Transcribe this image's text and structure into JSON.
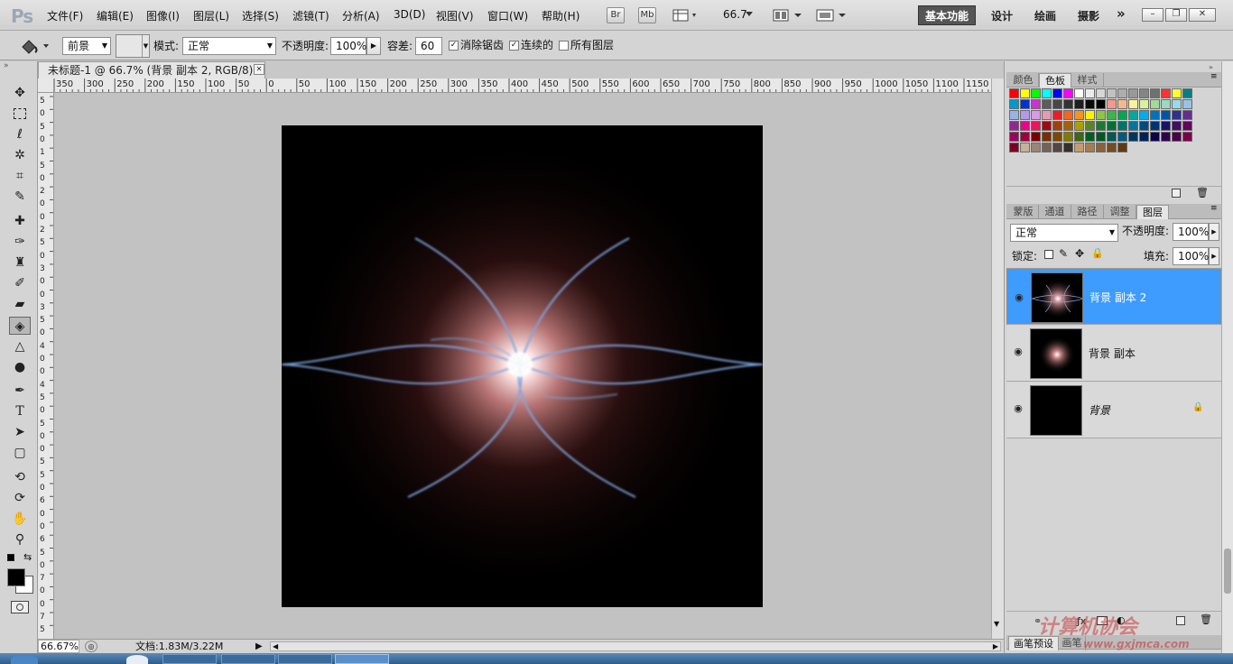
{
  "app": {
    "logo": "Ps"
  },
  "menu": [
    "文件(F)",
    "编辑(E)",
    "图像(I)",
    "图层(L)",
    "选择(S)",
    "滤镜(T)",
    "分析(A)",
    "3D(D)",
    "视图(V)",
    "窗口(W)",
    "帮助(H)"
  ],
  "appbar": {
    "bridge_label": "Br",
    "minibridge_label": "Mb",
    "zoom": "66.7"
  },
  "workspaces": {
    "active": "基本功能",
    "items": [
      "设计",
      "绘画",
      "摄影"
    ],
    "more": "»"
  },
  "window_controls": {
    "minimize": "–",
    "restore": "❐",
    "close": "✕"
  },
  "options": {
    "fill_source": "前景",
    "mode_label": "模式:",
    "mode_value": "正常",
    "opacity_label": "不透明度:",
    "opacity_value": "100%",
    "tolerance_label": "容差:",
    "tolerance_value": "60",
    "antialias_label": "消除锯齿",
    "antialias_checked": true,
    "contiguous_label": "连续的",
    "contiguous_checked": true,
    "all_layers_label": "所有图层",
    "all_layers_checked": false
  },
  "document": {
    "tab_title": "未标题-1 @ 66.7% (背景 副本 2, RGB/8) *",
    "close": "✕"
  },
  "ruler_top": [
    "350",
    "300",
    "250",
    "200",
    "150",
    "100",
    "50",
    "0",
    "50",
    "100",
    "150",
    "200",
    "250",
    "300",
    "350",
    "400",
    "450",
    "500",
    "550",
    "600",
    "650",
    "700",
    "750",
    "800",
    "850",
    "900",
    "950",
    "1000",
    "1050",
    "1100",
    "1150"
  ],
  "ruler_left": [
    "5",
    "0",
    "5",
    "0",
    "1",
    "5",
    "0",
    "2",
    "0",
    "0",
    "2",
    "5",
    "0",
    "3",
    "0",
    "0",
    "3",
    "5",
    "0",
    "4",
    "0",
    "0",
    "4",
    "5",
    "0",
    "5",
    "0",
    "0",
    "5",
    "5",
    "0",
    "6",
    "0",
    "0",
    "6",
    "5",
    "0",
    "7",
    "0",
    "0",
    "7",
    "5"
  ],
  "status": {
    "zoom": "66.67%",
    "doc_info": "文档:1.83M/3.22M"
  },
  "swatch_tabs": [
    "颜色",
    "色板",
    "样式"
  ],
  "swatch_tab_active": "色板",
  "swatch_colors": [
    "#ff0000",
    "#ffff00",
    "#00ff00",
    "#00ffff",
    "#0000ff",
    "#ff00ff",
    "#ffffff",
    "#ebebeb",
    "#d6d6d6",
    "#c2c2c2",
    "#adadad",
    "#999999",
    "#858585",
    "#707070",
    "#ff3333",
    "#ffff33",
    "#008080",
    "#0099cc",
    "#0033cc",
    "#cc33cc",
    "#5c5c5c",
    "#474747",
    "#333333",
    "#1f1f1f",
    "#0a0a0a",
    "#000000",
    "#f2998c",
    "#f5b88c",
    "#fff29a",
    "#d9f29a",
    "#a3d99a",
    "#9ad9c2",
    "#9ad9e6",
    "#99c2e6",
    "#9ab3e6",
    "#b39ae6",
    "#d99ae6",
    "#e699b3",
    "#ed1c24",
    "#f26522",
    "#f7941d",
    "#fff200",
    "#8dc63f",
    "#39b54a",
    "#00a651",
    "#00a99d",
    "#00aeef",
    "#0072bc",
    "#0054a6",
    "#2e3192",
    "#662d91",
    "#92278f",
    "#ec008c",
    "#ed145b",
    "#9e0b0f",
    "#a0410d",
    "#a36209",
    "#aba000",
    "#598527",
    "#1a7b30",
    "#007236",
    "#00746b",
    "#0076a3",
    "#004b80",
    "#003471",
    "#1b1464",
    "#440e62",
    "#630460",
    "#9e005d",
    "#9e0039",
    "#790000",
    "#7b2e00",
    "#7d4900",
    "#827b00",
    "#406618",
    "#005e20",
    "#005826",
    "#005952",
    "#005b7f",
    "#003663",
    "#002157",
    "#0d004c",
    "#32004b",
    "#4b0049",
    "#7b0046",
    "#7a0026",
    "#c7b299",
    "#998675",
    "#736357",
    "#534741",
    "#362f2d",
    "#c69c6d",
    "#a67c52",
    "#8c6239",
    "#754c24",
    "#603913"
  ],
  "layers_tabs": [
    "蒙版",
    "通道",
    "路径",
    "调整",
    "图层"
  ],
  "layers_tab_active": "图层",
  "layers_panel": {
    "blend_mode": "正常",
    "opacity_label": "不透明度:",
    "opacity_value": "100%",
    "lock_label": "锁定:",
    "fill_label": "填充:",
    "fill_value": "100%"
  },
  "layers": [
    {
      "name": "背景 副本 2",
      "selected": true
    },
    {
      "name": "背景 副本",
      "selected": false
    },
    {
      "name": "背景",
      "selected": false,
      "locked": true
    }
  ],
  "bottom_tabs": [
    "画笔预设",
    "画笔"
  ],
  "watermark": {
    "line1": "计算机协会",
    "line2": "www.gxjmca.com"
  }
}
